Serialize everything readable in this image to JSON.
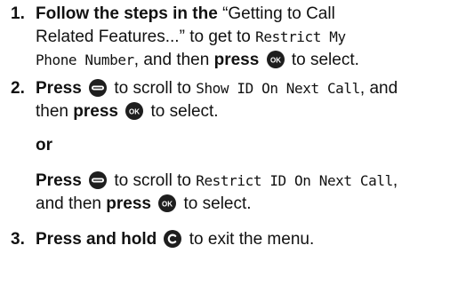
{
  "steps": [
    {
      "number": "1.",
      "bold_1": "Follow the steps in the",
      "quote": " “Getting to Call",
      "line2_text": "Related Features...” to get to ",
      "lcd_1": "Restrict My",
      "lcd_2": "Phone Number",
      "line3_mid": ", and then ",
      "bold_press": "press",
      "icon": "ok-key-icon",
      "tail": " to select."
    },
    {
      "number": "2.",
      "bold_press": "Press",
      "icon_scroll": "menu-key-icon",
      "mid": " to scroll to ",
      "lcd": "Show ID On Next Call",
      "after_lcd": ", and",
      "line2_a": "then ",
      "bold_press_2": "press",
      "icon_ok": "ok-key-icon",
      "tail": " to select."
    }
  ],
  "or_label": "or",
  "alt_step": {
    "bold_press": "Press",
    "icon_scroll": "menu-key-icon",
    "mid": " to scroll to ",
    "lcd": "Restrict ID On Next Call",
    "after_lcd": ",",
    "line2_a": "and then ",
    "bold_press_2": "press",
    "icon_ok": "ok-key-icon",
    "tail": " to select."
  },
  "step3": {
    "number": "3.",
    "bold": "Press and hold",
    "icon": "clear-key-icon",
    "tail": " to exit the menu."
  }
}
